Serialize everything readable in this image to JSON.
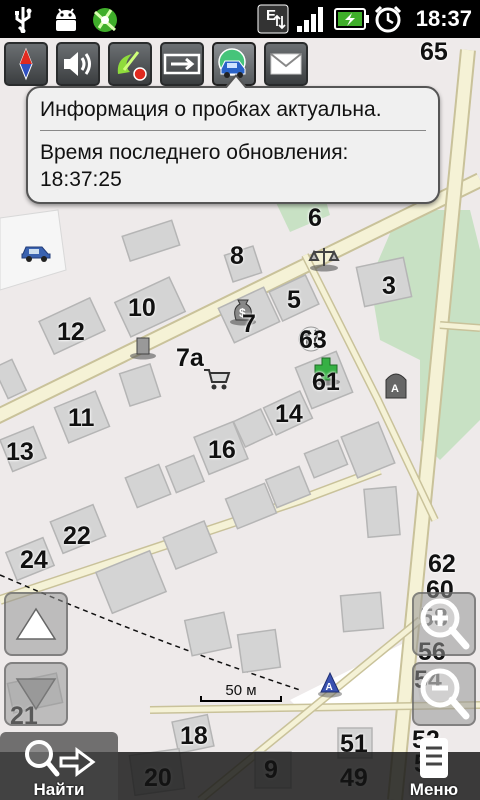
{
  "status_bar": {
    "time": "18:37",
    "network_label": "E",
    "icons": [
      "usb-icon",
      "android-debug-icon",
      "gps-satellite-icon",
      "network-e-icon",
      "signal-icon",
      "battery-charging-icon",
      "alarm-clock-icon"
    ]
  },
  "map": {
    "badge_top_right": "65",
    "house_numbers": [
      "6",
      "8",
      "3",
      "5",
      "10",
      "12",
      "7",
      "63",
      "7а",
      "61",
      "11",
      "14",
      "13",
      "16",
      "22",
      "24",
      "62",
      "60",
      "58",
      "56",
      "54",
      "21",
      "18",
      "52",
      "51",
      "20",
      "9",
      "49",
      "50"
    ],
    "scale_label": "50 м"
  },
  "toolbar": {
    "buttons": [
      "compass-icon",
      "sound-icon",
      "gps-status-icon",
      "navigation-route-icon",
      "traffic-icon",
      "messages-icon"
    ]
  },
  "tooltip": {
    "line1": "Информация о пробках актуальна.",
    "line2": "Время последнего обновления:",
    "line3": "18:37:25"
  },
  "bottom": {
    "find_label": "Найти",
    "menu_label": "Меню"
  },
  "colors": {
    "road": "#f5f2d6",
    "road_border": "#c9c29a",
    "park": "#c8e1c4",
    "building": "#d4d4d4",
    "map_bg": "#eeeaea"
  }
}
